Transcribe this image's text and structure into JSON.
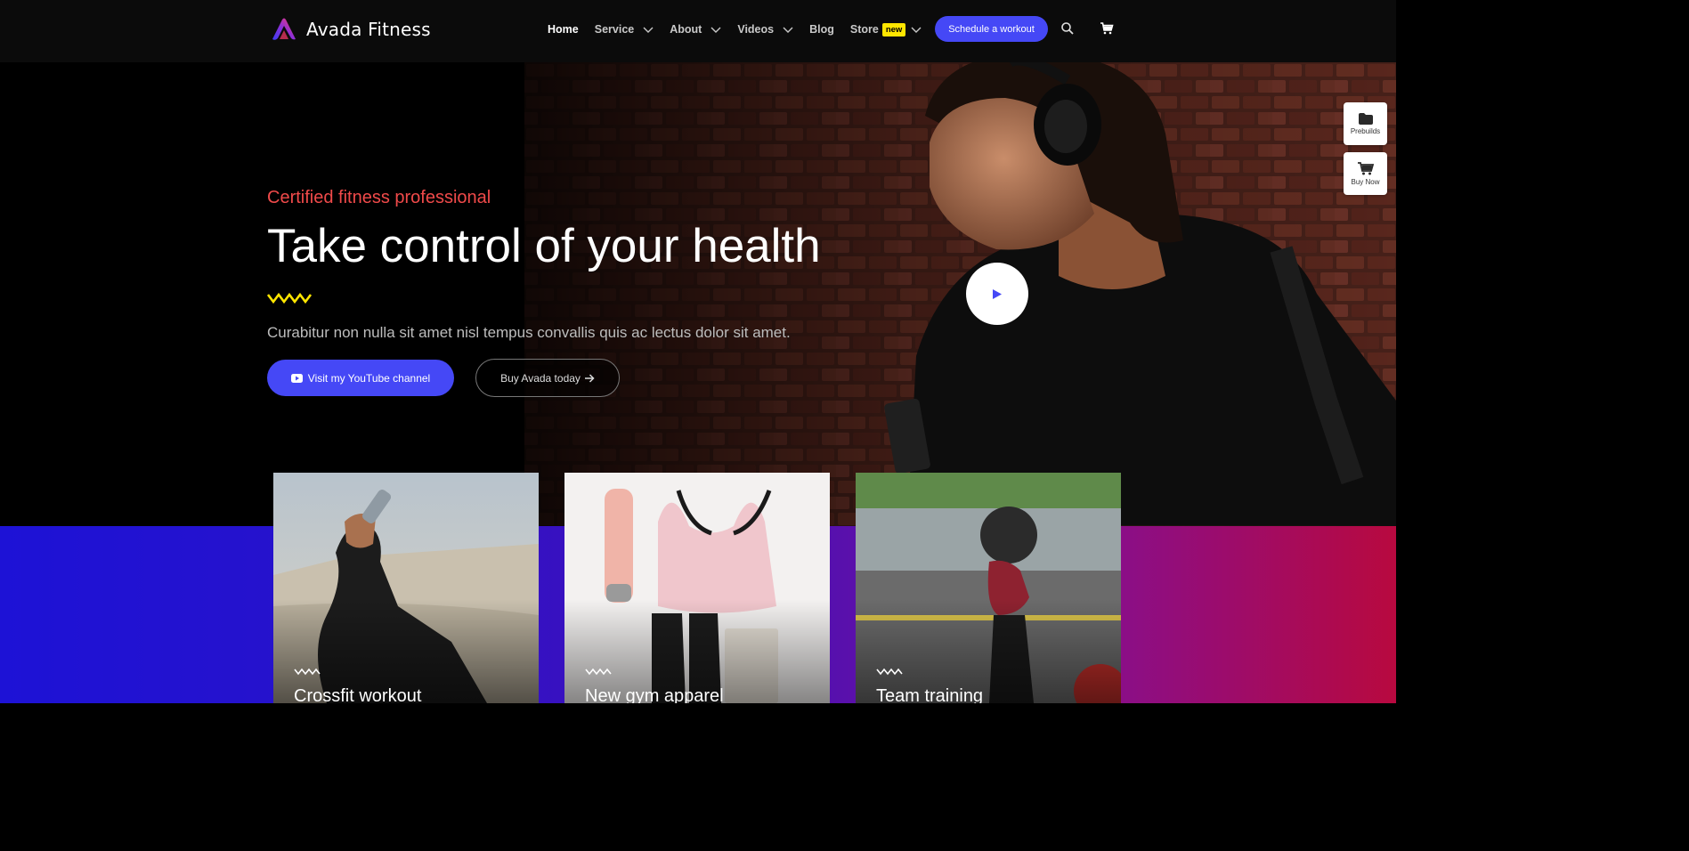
{
  "header": {
    "logo_text": "Avada Fitness",
    "nav": [
      {
        "label": "Home",
        "active": true,
        "has_dropdown": false
      },
      {
        "label": "Service",
        "active": false,
        "has_dropdown": true
      },
      {
        "label": "About",
        "active": false,
        "has_dropdown": true
      },
      {
        "label": "Videos",
        "active": false,
        "has_dropdown": true
      },
      {
        "label": "Blog",
        "active": false,
        "has_dropdown": false
      },
      {
        "label": "Store",
        "active": false,
        "has_dropdown": true,
        "badge": "new"
      }
    ],
    "cta_label": "Schedule a workout",
    "search_icon": "search-icon",
    "cart_icon": "cart-icon"
  },
  "hero": {
    "eyebrow": "Certified fitness professional",
    "title": "Take control of your health",
    "subtitle": "Curabitur non nulla sit amet nisl tempus convallis quis ac lectus dolor sit amet.",
    "primary_button": "Visit my YouTube channel",
    "secondary_button": "Buy Avada today",
    "play_icon": "play-icon"
  },
  "side_widgets": [
    {
      "label": "Prebuilds",
      "icon": "folder-icon"
    },
    {
      "label": "Buy Now",
      "icon": "cart-icon"
    }
  ],
  "cards": [
    {
      "title": "Crossfit workout"
    },
    {
      "title": "New gym apparel"
    },
    {
      "title": "Team training"
    }
  ],
  "colors": {
    "accent": "#4548f6",
    "eyebrow": "#f04a4a",
    "badge": "#ffe600",
    "zigzag": "#ffe600"
  }
}
